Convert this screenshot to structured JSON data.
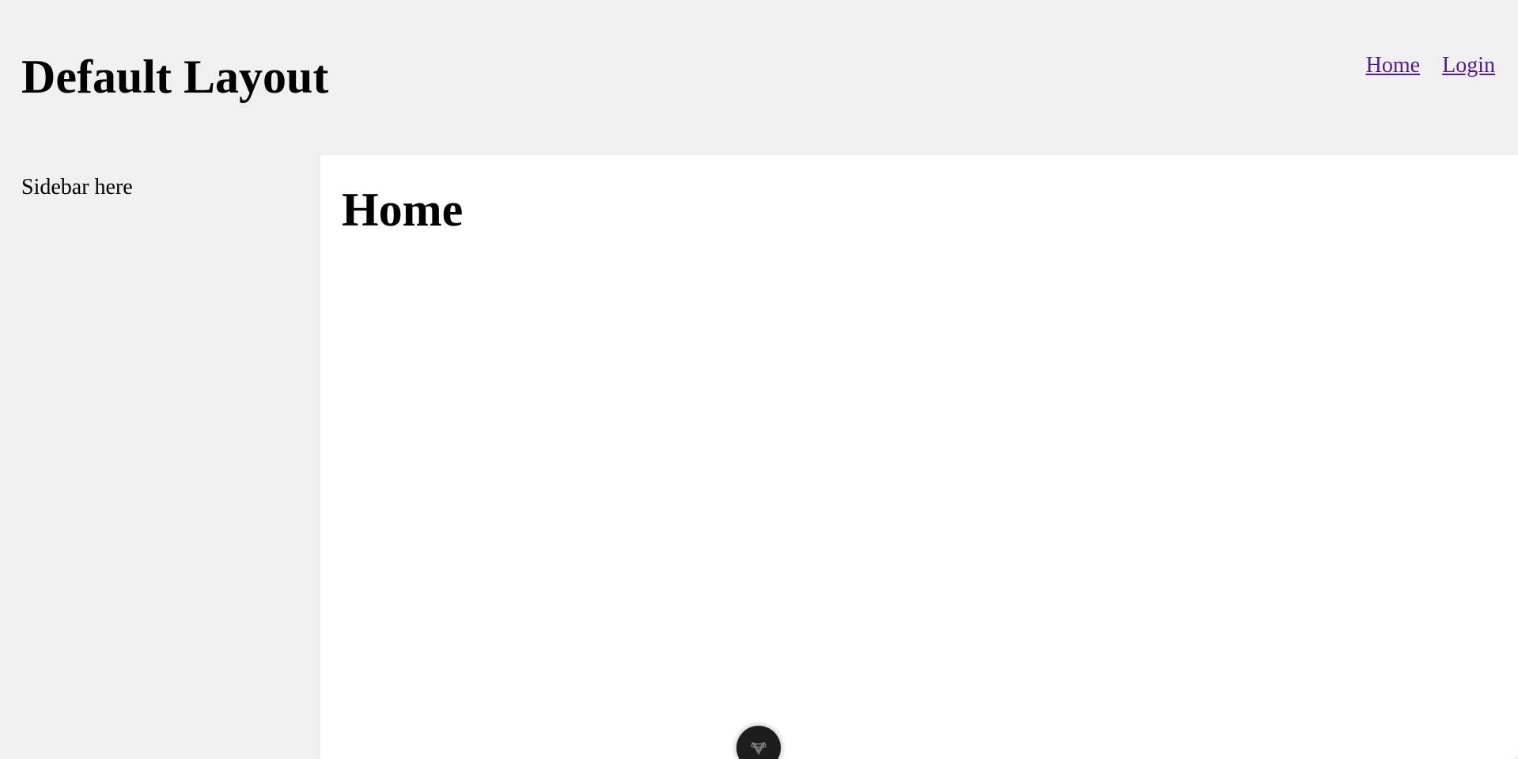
{
  "header": {
    "title": "Default Layout",
    "nav": [
      {
        "label": "Home"
      },
      {
        "label": "Login"
      }
    ]
  },
  "sidebar": {
    "text": "Sidebar here"
  },
  "main": {
    "title": "Home"
  },
  "devtools": {
    "icon": "vite-logo-icon"
  },
  "colors": {
    "page_background": "#f0f0f0",
    "content_background": "#ffffff",
    "visited_link": "#551a8b",
    "devtools_button": "#1d1d1d"
  }
}
